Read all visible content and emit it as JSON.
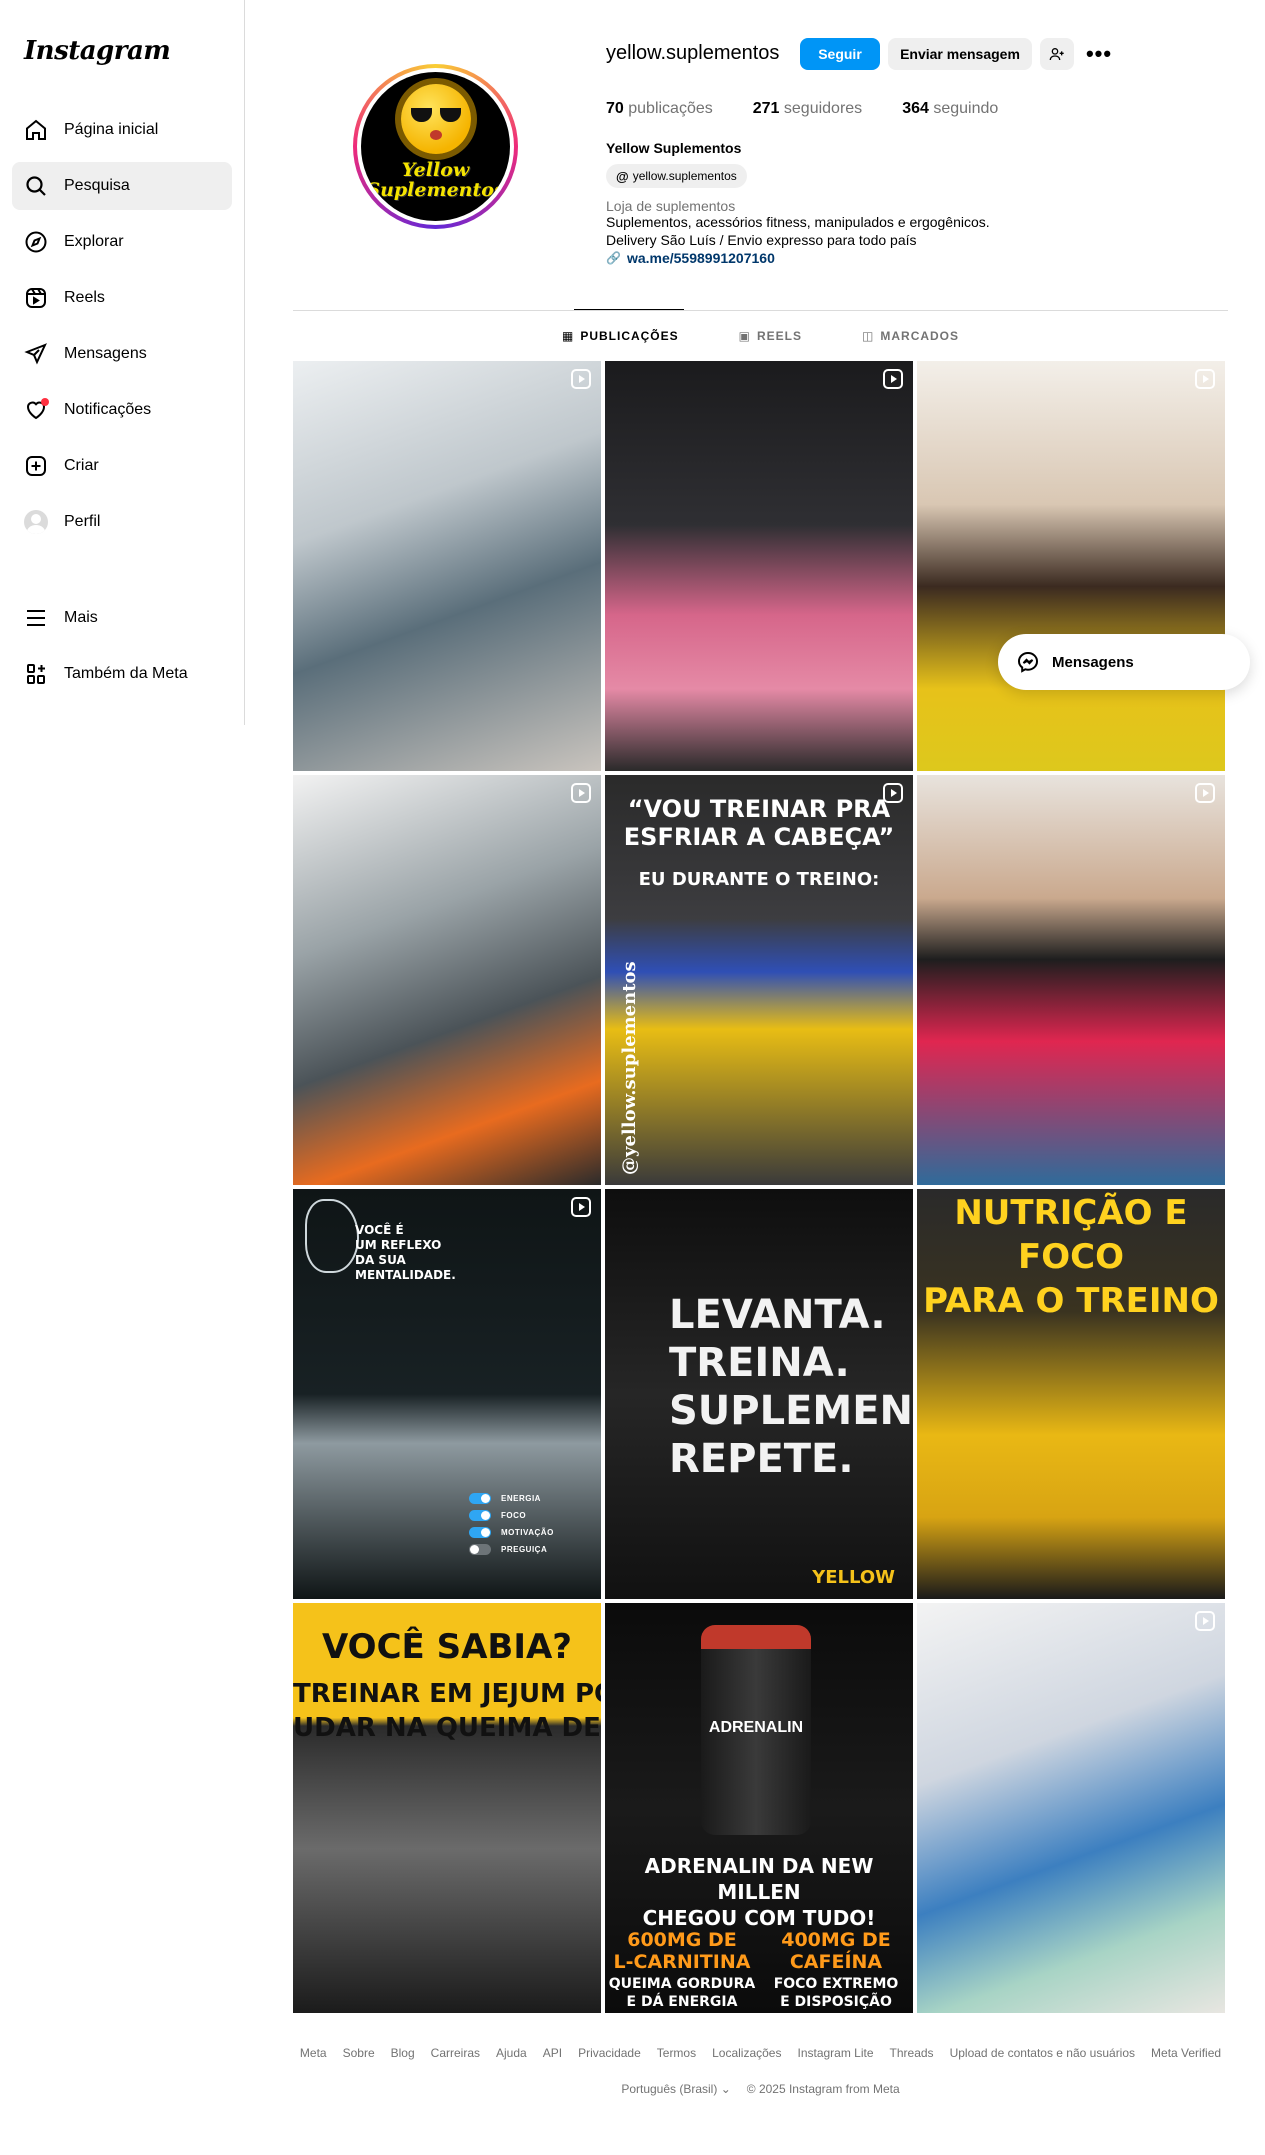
{
  "app": {
    "logo": "Instagram"
  },
  "sidebar": {
    "items": [
      {
        "label": "Página inicial"
      },
      {
        "label": "Pesquisa"
      },
      {
        "label": "Explorar"
      },
      {
        "label": "Reels"
      },
      {
        "label": "Mensagens"
      },
      {
        "label": "Notificações"
      },
      {
        "label": "Criar"
      },
      {
        "label": "Perfil"
      }
    ],
    "bottom": [
      {
        "label": "Mais"
      },
      {
        "label": "Também da Meta"
      }
    ]
  },
  "profile": {
    "username": "yellow.suplementos",
    "follow_label": "Seguir",
    "message_label": "Enviar mensagem",
    "more_label": "•••",
    "avatar_text": "Yellow Suplementos",
    "stats": {
      "posts_count": "70",
      "posts_label": "publicações",
      "followers_count": "271",
      "followers_label": "seguidores",
      "following_count": "364",
      "following_label": "seguindo"
    },
    "full_name": "Yellow Suplementos",
    "threads_handle": "yellow.suplementos",
    "category": "Loja de suplementos",
    "bio_line1": "Suplementos, acessórios fitness, manipulados e ergogênicos.",
    "bio_line2": "Delivery São Luís / Envio expresso para todo país",
    "link": "wa.me/5598991207160"
  },
  "tabs": [
    {
      "label": "PUBLICAÇÕES",
      "active": true
    },
    {
      "label": "REELS",
      "active": false
    },
    {
      "label": "MARCADOS",
      "active": false
    }
  ],
  "posts": {
    "p5": {
      "line1": "“VOU TREINAR PRA",
      "line2": "ESFRIAR A CABEÇA”",
      "line3": "EU DURANTE O TREINO:",
      "handle": "@yellow.suplementos"
    },
    "p7": {
      "text1": "VOCÊ É",
      "text2": "UM REFLEXO",
      "text3": "DA SUA",
      "text4": "MENTALIDADE.",
      "toggles": [
        "ENERGIA",
        "FOCO",
        "MOTIVAÇÃO",
        "PREGUIÇA"
      ]
    },
    "p8": {
      "line1": "LEVANTA.",
      "line2": "TREINA.",
      "line3": "SUPLEMENTA.",
      "line4": "REPETE.",
      "brand": "YELLOW"
    },
    "p9": {
      "line1": "NUTRIÇÃO E FOCO",
      "line2": "PARA O TREINO"
    },
    "p10": {
      "line1": "VOCÊ SABIA?",
      "line2": "TREINAR EM JEJUM POD",
      "line3": "UDAR NA QUEIMA DE GORDU"
    },
    "p11": {
      "bottle": "ADRENALIN",
      "headline1": "ADRENALIN DA NEW MILLEN",
      "headline2": "CHEGOU COM TUDO!",
      "left1": "600MG DE",
      "left2": "L-CARNITINA",
      "left3": "QUEIMA GORDURA",
      "left4": "E DÁ ENERGIA",
      "right1": "400MG DE",
      "right2": "CAFEÍNA",
      "right3": "FOCO EXTREMO",
      "right4": "E DISPOSIÇÃO"
    }
  },
  "messages_float": {
    "label": "Mensagens"
  },
  "footer": {
    "links": [
      "Meta",
      "Sobre",
      "Blog",
      "Carreiras",
      "Ajuda",
      "API",
      "Privacidade",
      "Termos",
      "Localizações",
      "Instagram Lite",
      "Threads",
      "Upload de contatos e não usuários",
      "Meta Verified"
    ],
    "language": "Português (Brasil)",
    "copyright": "© 2025 Instagram from Meta"
  },
  "colors": {
    "accent": "#0095f6",
    "notification": "#ff3040",
    "brand_yellow": "#f5c21a"
  }
}
